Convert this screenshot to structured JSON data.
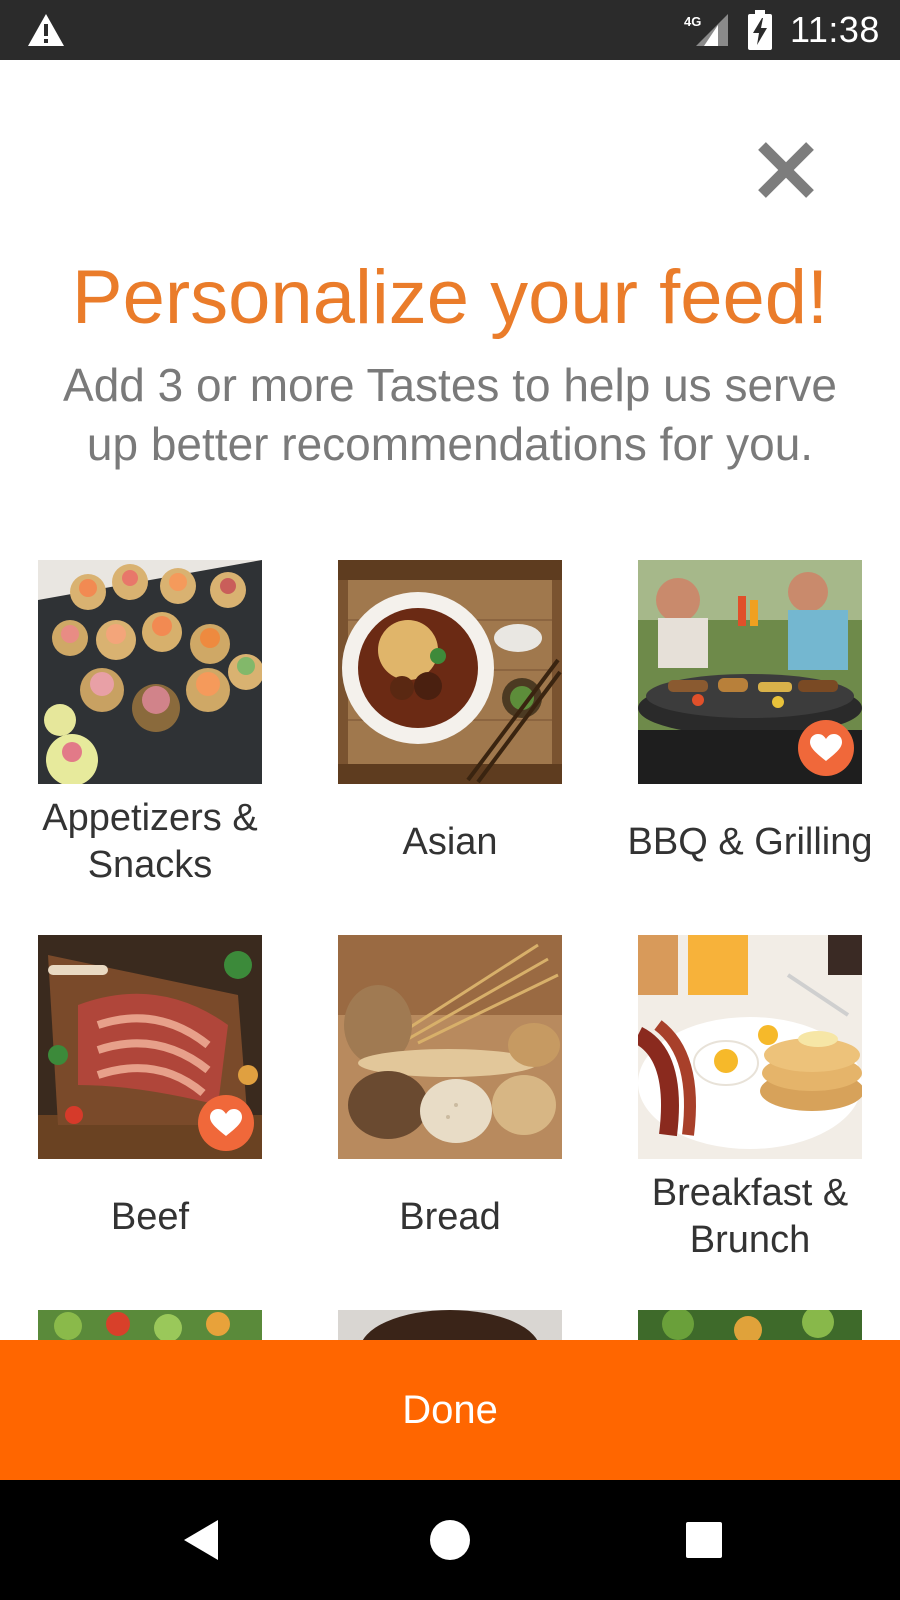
{
  "status_bar": {
    "time": "11:38",
    "network_label": "4G",
    "icons": [
      "warning-icon",
      "network-4g-icon",
      "battery-charging-icon"
    ]
  },
  "header": {
    "close_icon": "close-icon",
    "title": "Personalize your feed!",
    "subtitle": "Add 3 or more Tastes to help us serve up better recommendations for you."
  },
  "tastes": [
    {
      "label": "Appetizers & Snacks",
      "selected": false
    },
    {
      "label": "Asian",
      "selected": false
    },
    {
      "label": "BBQ & Grilling",
      "selected": true
    },
    {
      "label": "Beef",
      "selected": true
    },
    {
      "label": "Bread",
      "selected": false
    },
    {
      "label": "Breakfast & Brunch",
      "selected": false
    },
    {
      "label": "",
      "selected": false
    },
    {
      "label": "",
      "selected": false
    },
    {
      "label": "",
      "selected": false
    }
  ],
  "footer": {
    "done_label": "Done"
  },
  "navigation": {
    "icons": [
      "back-icon",
      "home-icon",
      "recents-icon"
    ]
  },
  "colors": {
    "accent": "#ea7c2a",
    "done_button": "#ff6600",
    "heart_badge": "#f0683a",
    "status_bar": "#2b2b2b",
    "nav_bar": "#000000"
  }
}
